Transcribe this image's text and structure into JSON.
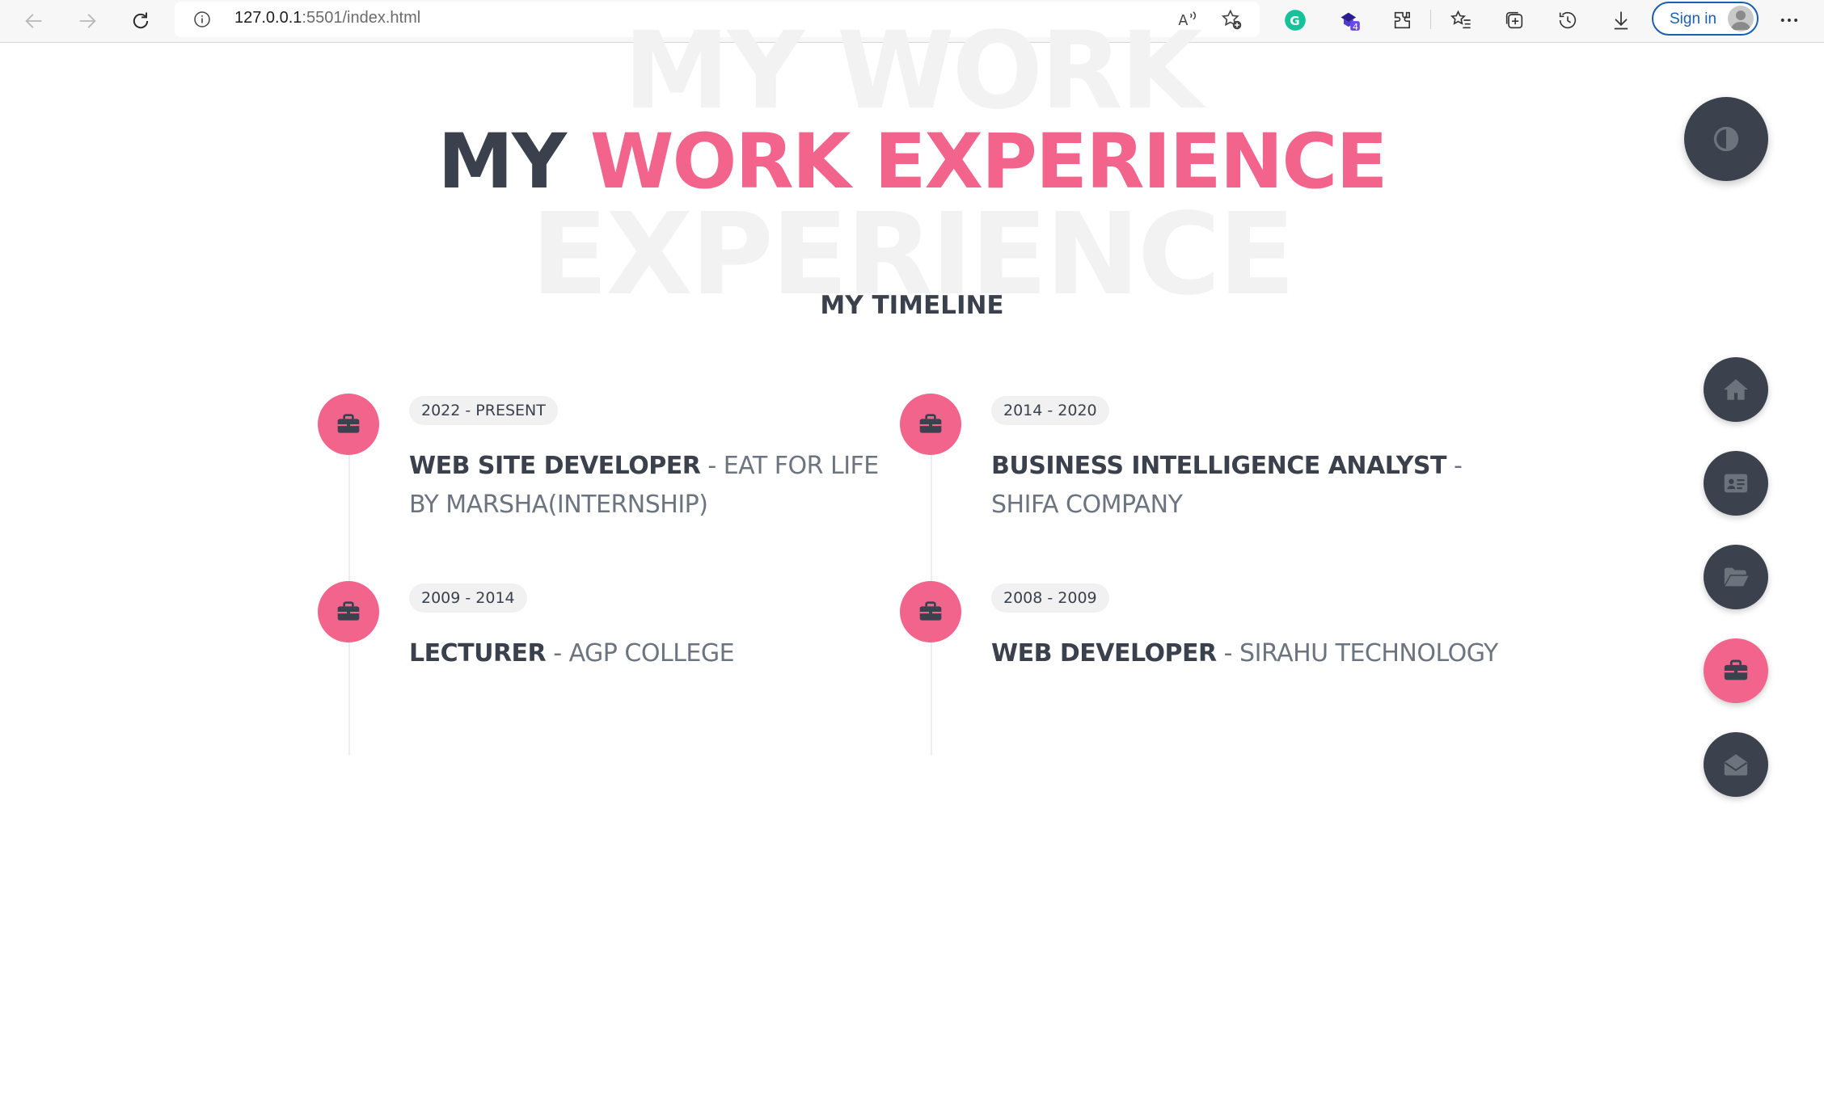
{
  "browser": {
    "url_host": "127.0.0.1",
    "url_path": ":5501/index.html",
    "signin_label": "Sign in",
    "extension_badge": "4",
    "icons": [
      "back-icon",
      "forward-icon",
      "refresh-icon",
      "info-icon",
      "read-aloud-icon",
      "add-favorite-icon",
      "grammarly-icon",
      "extension-icon",
      "extensions-icon",
      "favorites-icon",
      "collections-icon",
      "history-icon",
      "downloads-icon",
      "profile-icon",
      "more-icon"
    ]
  },
  "page": {
    "watermark_line1": "MY WORK",
    "watermark_line2": "EXPERIENCE",
    "title_part1": "MY ",
    "title_part2": "WORK EXPERIENCE",
    "subtitle": "MY TIMELINE",
    "accent_color": "#f3648d",
    "dark_color": "#3b424d"
  },
  "timeline": [
    {
      "year": "2022 - PRESENT",
      "role": "WEB SITE DEVELOPER",
      "separator": " - ",
      "org": "EAT FOR LIFE BY MARSHA(INTERNSHIP)",
      "icon": "briefcase-icon"
    },
    {
      "year": "2014 - 2020",
      "role": "BUSINESS INTELLIGENCE ANALYST",
      "separator": " - ",
      "org": "SHIFA COMPANY",
      "icon": "briefcase-icon"
    },
    {
      "year": "2009 - 2014",
      "role": "LECTURER",
      "separator": " - ",
      "org": "AGP COLLEGE",
      "icon": "briefcase-icon"
    },
    {
      "year": "2008 - 2009",
      "role": "WEB DEVELOPER",
      "separator": " - ",
      "org": "SIRAHU TECHNOLOGY",
      "icon": "briefcase-icon"
    }
  ],
  "side_nav": {
    "theme_toggle_icon": "contrast-icon",
    "items": [
      {
        "icon": "home-icon",
        "active": false
      },
      {
        "icon": "id-card-icon",
        "active": false
      },
      {
        "icon": "folder-open-icon",
        "active": false
      },
      {
        "icon": "briefcase-icon",
        "active": true
      },
      {
        "icon": "envelope-open-icon",
        "active": false
      }
    ]
  }
}
